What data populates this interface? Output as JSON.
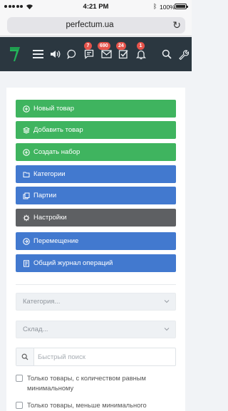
{
  "status_bar": {
    "time": "4:21 PM",
    "battery": "100%"
  },
  "browser": {
    "url": "perfectum.ua",
    "reload_icon": "reload-icon"
  },
  "navbar": {
    "icons": [
      "logo-icon",
      "hamburger-icon",
      "volume-icon",
      "chat-icon",
      "messages-icon",
      "mail-icon",
      "tasks-icon",
      "bell-icon",
      "search-icon",
      "wrench-icon"
    ],
    "badges": {
      "messages": "7",
      "mail": "690",
      "tasks": "24",
      "bell": "1"
    }
  },
  "colors": {
    "navbar": "#2b3740",
    "green": "#3fb45f",
    "blue": "#4279cf",
    "gray": "#5e6063",
    "badge": "#e5534b",
    "logo": "#23b35a"
  },
  "actions": [
    {
      "label": "Новый товар",
      "icon": "plus-circle-icon",
      "color": "green"
    },
    {
      "label": "Добавить товар",
      "icon": "layers-icon",
      "color": "green"
    },
    {
      "label": "Создать набор",
      "icon": "plus-circle-icon",
      "color": "green"
    },
    {
      "label": "Категории",
      "icon": "folder-icon",
      "color": "blue"
    },
    {
      "label": "Партии",
      "icon": "copy-icon",
      "color": "blue"
    },
    {
      "label": "Настройки",
      "icon": "gear-icon",
      "color": "gray"
    },
    {
      "label": "Перемещение",
      "icon": "arrow-circle-icon",
      "color": "blue"
    },
    {
      "label": "Общий журнал операций",
      "icon": "journal-icon",
      "color": "blue"
    }
  ],
  "filters": {
    "category_placeholder": "Категория...",
    "warehouse_placeholder": "Склад...",
    "search_placeholder": "Быстрый поиск"
  },
  "checkboxes": [
    {
      "label": "Только товары, с количеством равным минимальному",
      "checked": false
    },
    {
      "label": "Только товары, меньше минимального",
      "checked": false
    }
  ]
}
